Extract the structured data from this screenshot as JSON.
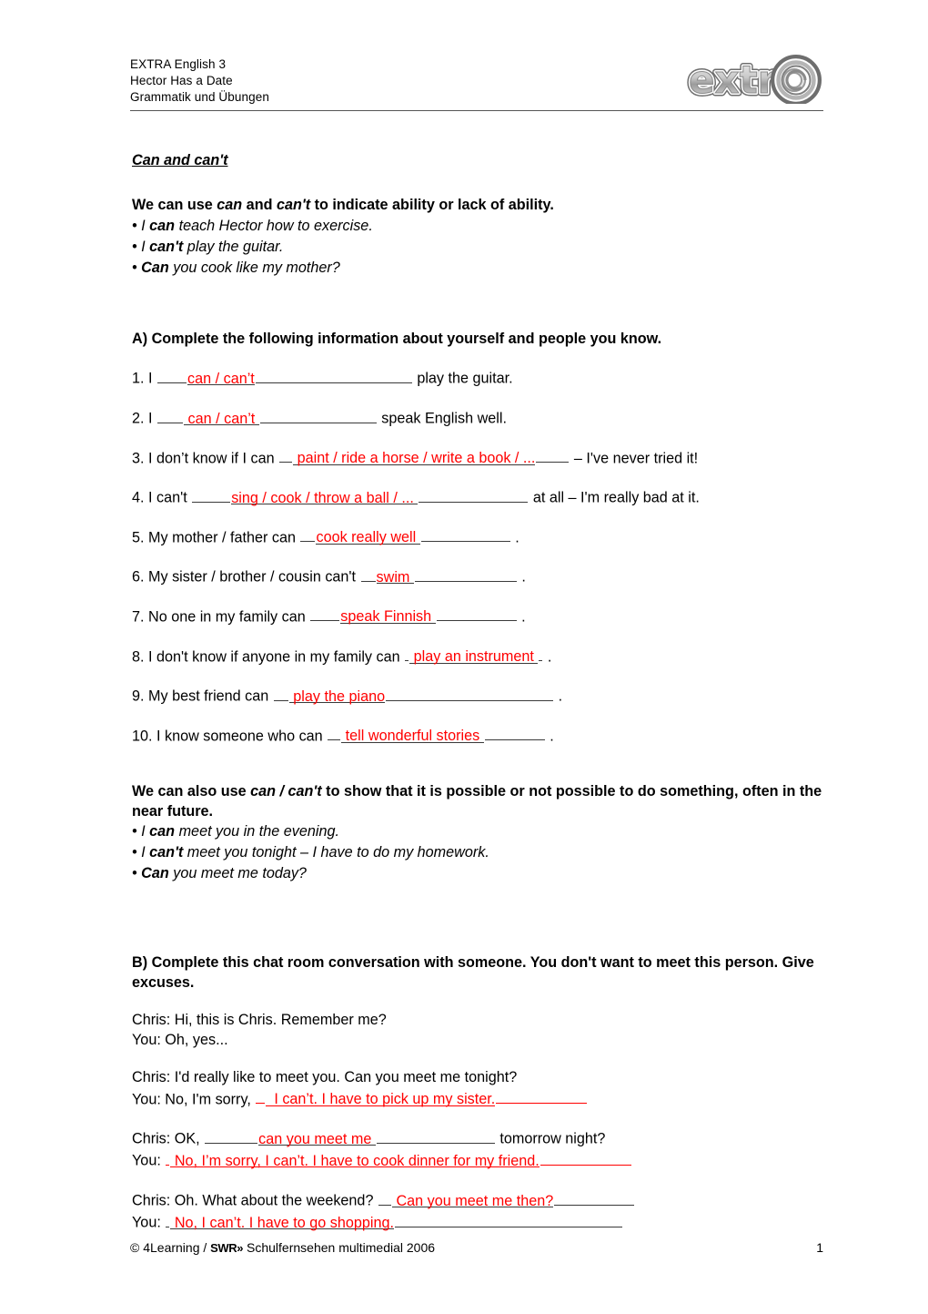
{
  "header": {
    "line1": "EXTRA English 3",
    "line2": "Hector Has a Date",
    "line3": "Grammatik und Übungen",
    "logo_text": "extr@"
  },
  "colors": {
    "answer_red": "#ff0000",
    "rule_grey": "#555555",
    "blank_line": "#3a3a3a"
  },
  "section_can": {
    "title": "Can and can't ",
    "rule_intro_pre": "We can use ",
    "rule_intro_word1": "can",
    "rule_intro_mid": " and ",
    "rule_intro_word2": "can't",
    "rule_intro_post": " to indicate ability or lack of ability.",
    "bullets": [
      {
        "pre": "I ",
        "strong": "can",
        "post": " teach Hector how to exercise."
      },
      {
        "pre": "I ",
        "strong": "can't",
        "post": " play the guitar."
      },
      {
        "pre": "",
        "strong": "Can",
        "post": " you cook like my mother?"
      }
    ]
  },
  "task_a": {
    "heading": "A) Complete the following information about yourself and people you know.",
    "questions": [
      {
        "num": "1.",
        "pre": "I",
        "answer": "can / can’t",
        "post": "play the guitar.",
        "lead_w": 32,
        "trail_w": 172,
        "red_underline": false
      },
      {
        "num": "2.",
        "pre": "I",
        "answer": " can / can’t ",
        "post": "speak English well.",
        "lead_w": 28,
        "trail_w": 128,
        "red_underline": false
      },
      {
        "num": "3.",
        "pre": "I don’t know if I can",
        "answer": " paint / ride a horse / write a book / ...",
        "post": "– I've never tried it!",
        "lead_w": 14,
        "trail_w": 36,
        "red_underline": false
      },
      {
        "num": "4.",
        "pre": "I can't",
        "answer": "sing / cook / throw a ball / ... ",
        "post": "at all – I'm really bad at it.",
        "lead_w": 42,
        "trail_w": 120,
        "red_underline": false
      },
      {
        "num": "5.",
        "pre": "My mother / father can",
        "answer": "cook really well ",
        "post": ".",
        "lead_w": 16,
        "trail_w": 98,
        "red_underline": false
      },
      {
        "num": "6.",
        "pre": "My sister / brother / cousin can't",
        "answer": "swim ",
        "post": ".",
        "lead_w": 16,
        "trail_w": 112,
        "red_underline": false
      },
      {
        "num": "7.",
        "pre": "No one in my family can",
        "answer": "speak Finnish ",
        "post": ".",
        "lead_w": 32,
        "trail_w": 88,
        "red_underline": false
      },
      {
        "num": "8.",
        "pre": "I don't know if anyone in my family can",
        "answer": " play an instrument ",
        "post": ". ",
        "lead_w": 4,
        "trail_w": 4,
        "red_underline": false
      },
      {
        "num": "9.",
        "pre": "My best friend can",
        "answer": " play the piano",
        "post": ".",
        "lead_w": 16,
        "trail_w": 184,
        "red_underline": false
      },
      {
        "num": "10.",
        "pre": "I know someone who can",
        "answer": " tell wonderful stories ",
        "post": ".",
        "lead_w": 14,
        "trail_w": 66,
        "red_underline": false
      }
    ]
  },
  "section_possible": {
    "rule_pre": "We can also use ",
    "rule_italic": "can / can't",
    "rule_post": "  to show that it is possible or not possible to do something, often in the near future.",
    "bullets": [
      {
        "pre": "I ",
        "strong": "can",
        "post": " meet you in the evening."
      },
      {
        "pre": "I ",
        "strong": "can't",
        "post": " meet you tonight – I have to do my homework."
      },
      {
        "pre": "",
        "strong": "Can",
        "post": " you meet me today?"
      }
    ]
  },
  "task_b": {
    "heading": "B) Complete this chat room conversation with someone. You don't want to meet this person. Give excuses.",
    "exchanges": [
      {
        "chris": "Chris: Hi, this is Chris. Remember me?",
        "you_pre": "You: Oh, yes...",
        "has_blank": false
      },
      {
        "chris": "Chris: I'd really like to meet you. Can you meet me tonight?",
        "you_pre": "You: No, I'm sorry,",
        "has_blank": true,
        "answer": "  I can’t. I have to pick up my sister.",
        "lead_w": 10,
        "trail_w": 100,
        "red_underline": true
      },
      {
        "chris_pre": "Chris: OK,",
        "chris_answer": "can you meet me ",
        "chris_lead_w": 58,
        "chris_trail_w": 130,
        "chris_post": "tomorrow night?",
        "you_pre": "You:",
        "has_blank": true,
        "answer": " No, I’m sorry, I can’t. I have to cook dinner for my friend.",
        "lead_w": 4,
        "trail_w": 100,
        "red_underline": true
      },
      {
        "chris_pre": "Chris: Oh. What about the weekend?",
        "chris_answer": " Can you meet me then?",
        "chris_lead_w": 14,
        "chris_trail_w": 88,
        "chris_post": "",
        "you_pre": "You:",
        "has_blank": true,
        "answer": " No, I can’t. I have to go shopping.",
        "lead_w": 4,
        "trail_w": 250,
        "red_underline": false
      }
    ]
  },
  "footer": {
    "copyright": "© 4Learning / ",
    "swr": "SWR»",
    "rest": " Schulfernsehen multimedial 2006",
    "page": "1"
  }
}
